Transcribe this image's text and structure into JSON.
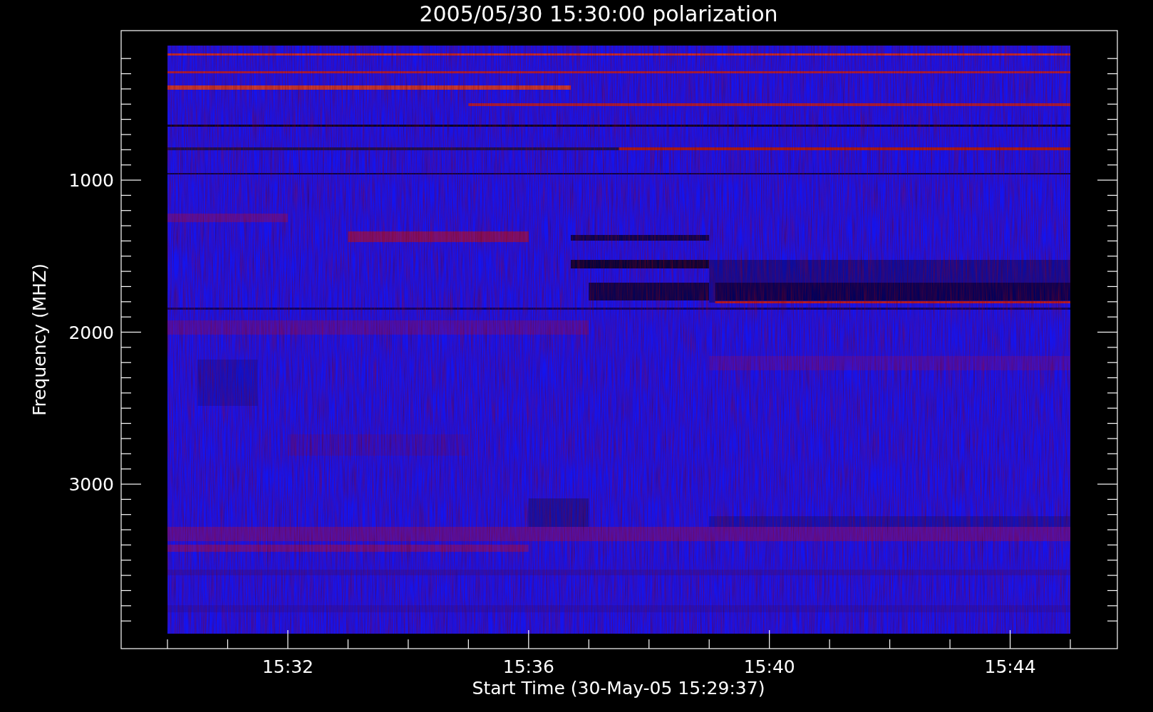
{
  "title": "2005/05/30 15:30:00 polarization",
  "ylabel": "Frequency (MHZ)",
  "xlabel": "Start Time (30-May-05 15:29:37)",
  "xticks": [
    {
      "label": "15:32"
    },
    {
      "label": "15:36"
    },
    {
      "label": "15:40"
    },
    {
      "label": "15:44"
    }
  ],
  "yticks": [
    {
      "label": "1000"
    },
    {
      "label": "2000"
    },
    {
      "label": "3000"
    }
  ]
}
